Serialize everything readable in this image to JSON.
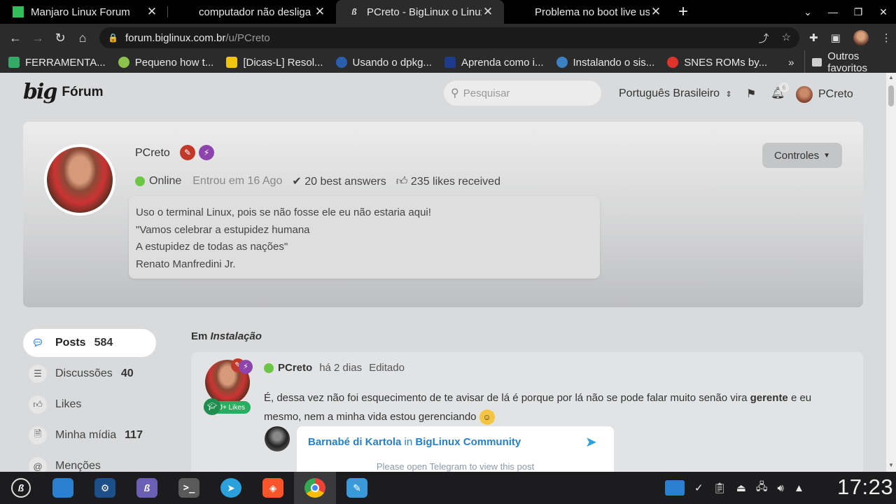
{
  "browser": {
    "tabs": [
      {
        "title": "Manjaro Linux Forum",
        "favicon_color": "#34be5b",
        "active": false
      },
      {
        "title": "computador não desliga - I",
        "favicon_color": "#000000",
        "active": false
      },
      {
        "title": "PCreto - BigLinux o Linux",
        "favicon_color": "#ffffff",
        "active": true
      },
      {
        "title": "Problema no boot live usb",
        "favicon_color": "#000000",
        "active": false
      }
    ],
    "new_tab_glyph": "+",
    "url_host": "forum.biglinux.com.br",
    "url_path": "/u/PCreto",
    "bookmarks": [
      {
        "label": "FERRAMENTA...",
        "color": "#3a6"
      },
      {
        "label": "Pequeno how t...",
        "color": "#8bc34a"
      },
      {
        "label": "[Dicas-L] Resol...",
        "color": "#f1c40f"
      },
      {
        "label": "Usando o dpkg...",
        "color": "#2a5db0"
      },
      {
        "label": "Aprenda como i...",
        "color": "#1e3a8a"
      },
      {
        "label": "Instalando o sis...",
        "color": "#3b82c4"
      },
      {
        "label": "SNES ROMs by...",
        "color": "#e0342a"
      }
    ],
    "bookmarks_more": "»",
    "other_bookmarks": "Outros favoritos"
  },
  "forum": {
    "logo_mark": "big",
    "logo_label": "Fórum",
    "search_placeholder": "Pesquisar",
    "language": "Português Brasileiro",
    "notification_count": "6",
    "current_user": "PCreto"
  },
  "profile": {
    "username": "PCreto",
    "status": "Online",
    "joined": "Entrou em 16 Ago",
    "best_answers": "20 best answers",
    "likes_received": "235 likes received",
    "bio_lines": [
      "Uso o terminal Linux, pois se não fosse ele eu não estaria aqui!",
      "\"Vamos celebrar a estupidez humana",
      "A estupidez de todas as nações\"",
      "Renato Manfredini Jr."
    ],
    "controls_label": "Controles"
  },
  "sidebar": {
    "items": [
      {
        "label": "Posts",
        "count": "584",
        "icon": "chat-icon"
      },
      {
        "label": "Discussões",
        "count": "40",
        "icon": "list-icon"
      },
      {
        "label": "Likes",
        "count": "",
        "icon": "thumbs-up-icon"
      },
      {
        "label": "Minha mídia",
        "count": "117",
        "icon": "file-icon"
      },
      {
        "label": "Menções",
        "count": "",
        "icon": "at-icon"
      }
    ]
  },
  "post": {
    "context_prefix": "Em",
    "context_topic": "Instalação",
    "author": "PCreto",
    "time": "há 2 dias",
    "edited": "Editado",
    "likes_badge": "J+ Likes",
    "text_before": "É, dessa vez não foi esquecimento de te avisar de lá é porque por lá não se pode falar muito senão vira ",
    "text_bold": "gerente",
    "text_after": " e eu mesmo, nem a minha vida estou gerenciando",
    "telegram": {
      "author": "Barnabé di Kartola",
      "in_word": "in",
      "channel": "BigLinux Community",
      "note": "Please open Telegram to view this post"
    }
  },
  "taskbar": {
    "clock": "17:23"
  }
}
